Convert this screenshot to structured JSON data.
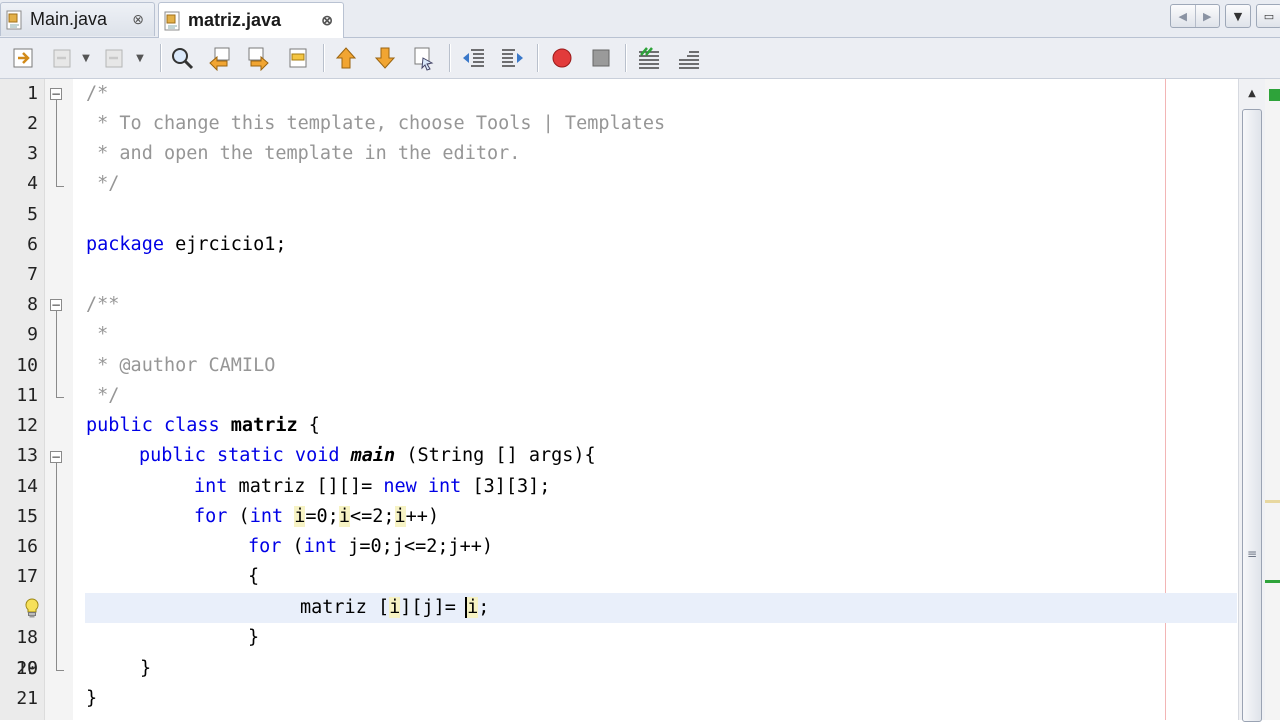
{
  "tabs": [
    {
      "label": "Main.java",
      "active": false,
      "close": "⊗"
    },
    {
      "label": "matriz.java",
      "active": true,
      "close": "⊗"
    }
  ],
  "tab_controls": {
    "prev": "◀",
    "next": "▶",
    "dropdown": "▼",
    "maximize": "▭"
  },
  "toolbar_icons": [
    "last-edit-icon",
    "back-icon",
    "forward-icon",
    "find-icon",
    "find-previous-icon",
    "find-next-icon",
    "toggle-highlight-icon",
    "previous-bookmark-icon",
    "next-bookmark-icon",
    "toggle-bookmark-icon",
    "shift-left-icon",
    "shift-right-icon",
    "start-macro-icon",
    "stop-macro-icon",
    "comment-icon",
    "uncomment-icon"
  ],
  "editor": {
    "file": "matriz.java",
    "line_numbers": [
      "1",
      "2",
      "3",
      "4",
      "5",
      "6",
      "7",
      "8",
      "9",
      "10",
      "11",
      "12",
      "13",
      "14",
      "15",
      "16",
      "17",
      "18",
      "19",
      "20",
      "21"
    ],
    "current_line": "18",
    "hint_icon": "lightbulb-icon",
    "lines": {
      "l1": "/*",
      "l2": " * To change this template, choose Tools | Templates",
      "l3": " * and open the template in the editor.",
      "l4": " */",
      "l6_kw": "package",
      "l6_rest": " ejrcicio1;",
      "l8": "/**",
      "l9": " *",
      "l10": " * @author CAMILO",
      "l11": " */",
      "l12_kw": "public class",
      "l12_name": "matriz",
      "l12_rest": " {",
      "l13_kw": "public static void",
      "l13_name": "main",
      "l13_rest": " (String [] args){",
      "l14_kw": "int",
      "l14_mid": " matriz [][]= ",
      "l14_kw2": "new int",
      "l14_rest": " [3][3];",
      "l15_kw": "for",
      "l15_a": " (",
      "l15_kw2": "int",
      "l15_b": " ",
      "l15_i1": "i",
      "l15_c": "=0;",
      "l15_i2": "i",
      "l15_d": "<=2;",
      "l15_i3": "i",
      "l15_e": "++)",
      "l16_kw": "for",
      "l16_a": " (",
      "l16_kw2": "int",
      "l16_rest": " j=0;j<=2;j++)",
      "l17": "{",
      "l18_a": "matriz [",
      "l18_i": "i",
      "l18_b": "][j]= ",
      "l18_i2": "i",
      "l18_c": ";",
      "l19": "}",
      "l20": "}",
      "l21": "}"
    }
  },
  "scrollbar": {
    "up_arrow": "▲",
    "grip": "≡"
  },
  "colors": {
    "keyword": "#0000e6",
    "comment": "#969696",
    "occurrence_highlight": "#f7f3c4",
    "current_line": "#e9effa",
    "ok_marker": "#2ea33a"
  }
}
